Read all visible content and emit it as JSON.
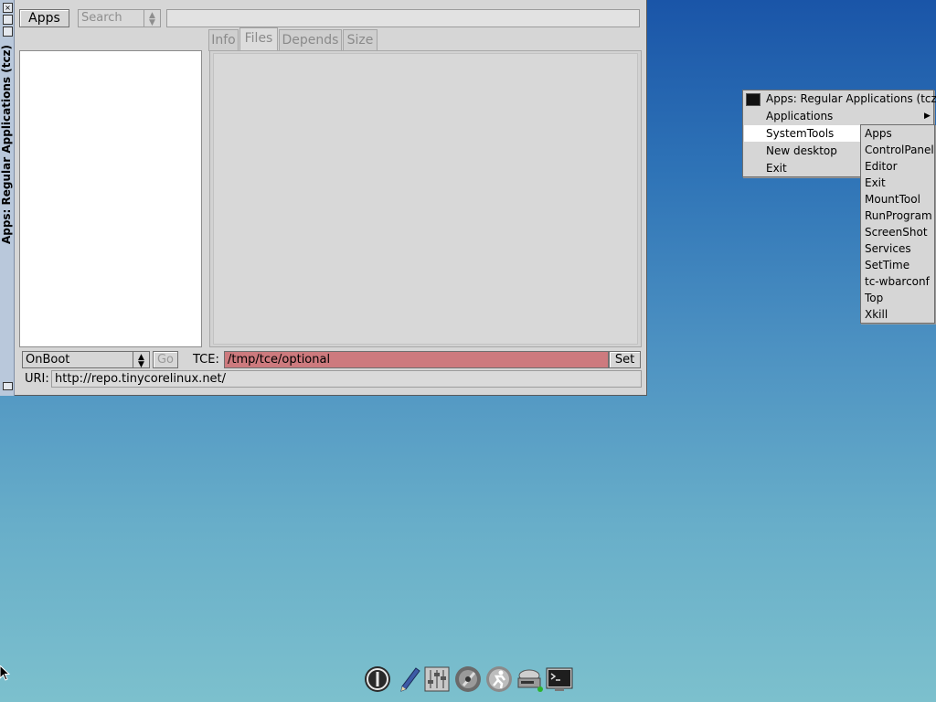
{
  "window": {
    "title": "Apps: Regular Applications (tcz)",
    "titlebar_buttons": [
      "close-icon",
      "maximize-icon",
      "minimize-icon",
      "iconify-icon"
    ],
    "toolbar": {
      "apps_label": "Apps",
      "search_mode": "Search",
      "search_value": ""
    },
    "tabs": [
      {
        "label": "Info",
        "active": false
      },
      {
        "label": "Files",
        "active": true
      },
      {
        "label": "Depends",
        "active": false
      },
      {
        "label": "Size",
        "active": false
      }
    ],
    "bottom": {
      "install_mode": "OnBoot",
      "go_label": "Go",
      "tce_label": "TCE:",
      "tce_path": "/tmp/tce/optional",
      "set_label": "Set",
      "uri_label": "URI:",
      "uri_value": "http://repo.tinycorelinux.net/"
    }
  },
  "root_menu": {
    "header": "Apps: Regular Applications (tcz)",
    "items": [
      "Applications",
      "SystemTools",
      "New desktop",
      "Exit"
    ],
    "highlighted": "SystemTools"
  },
  "submenu": {
    "items": [
      "Apps",
      "ControlPanel",
      "Editor",
      "Exit",
      "MountTool",
      "RunProgram",
      "ScreenShot",
      "Services",
      "SetTime",
      "tc-wbarconf",
      "Top",
      "Xkill"
    ]
  },
  "dock": {
    "icons": [
      "logout-icon",
      "editor-pen-icon",
      "control-panel-icon",
      "apps-icon",
      "run-icon",
      "mount-tool-icon",
      "terminal-icon"
    ]
  },
  "colors": {
    "tce_field_bg": "#cd7a7e",
    "desktop_top": "#1a55a8",
    "desktop_bottom": "#7cc0cd",
    "menu_highlight": "#ffffff"
  }
}
